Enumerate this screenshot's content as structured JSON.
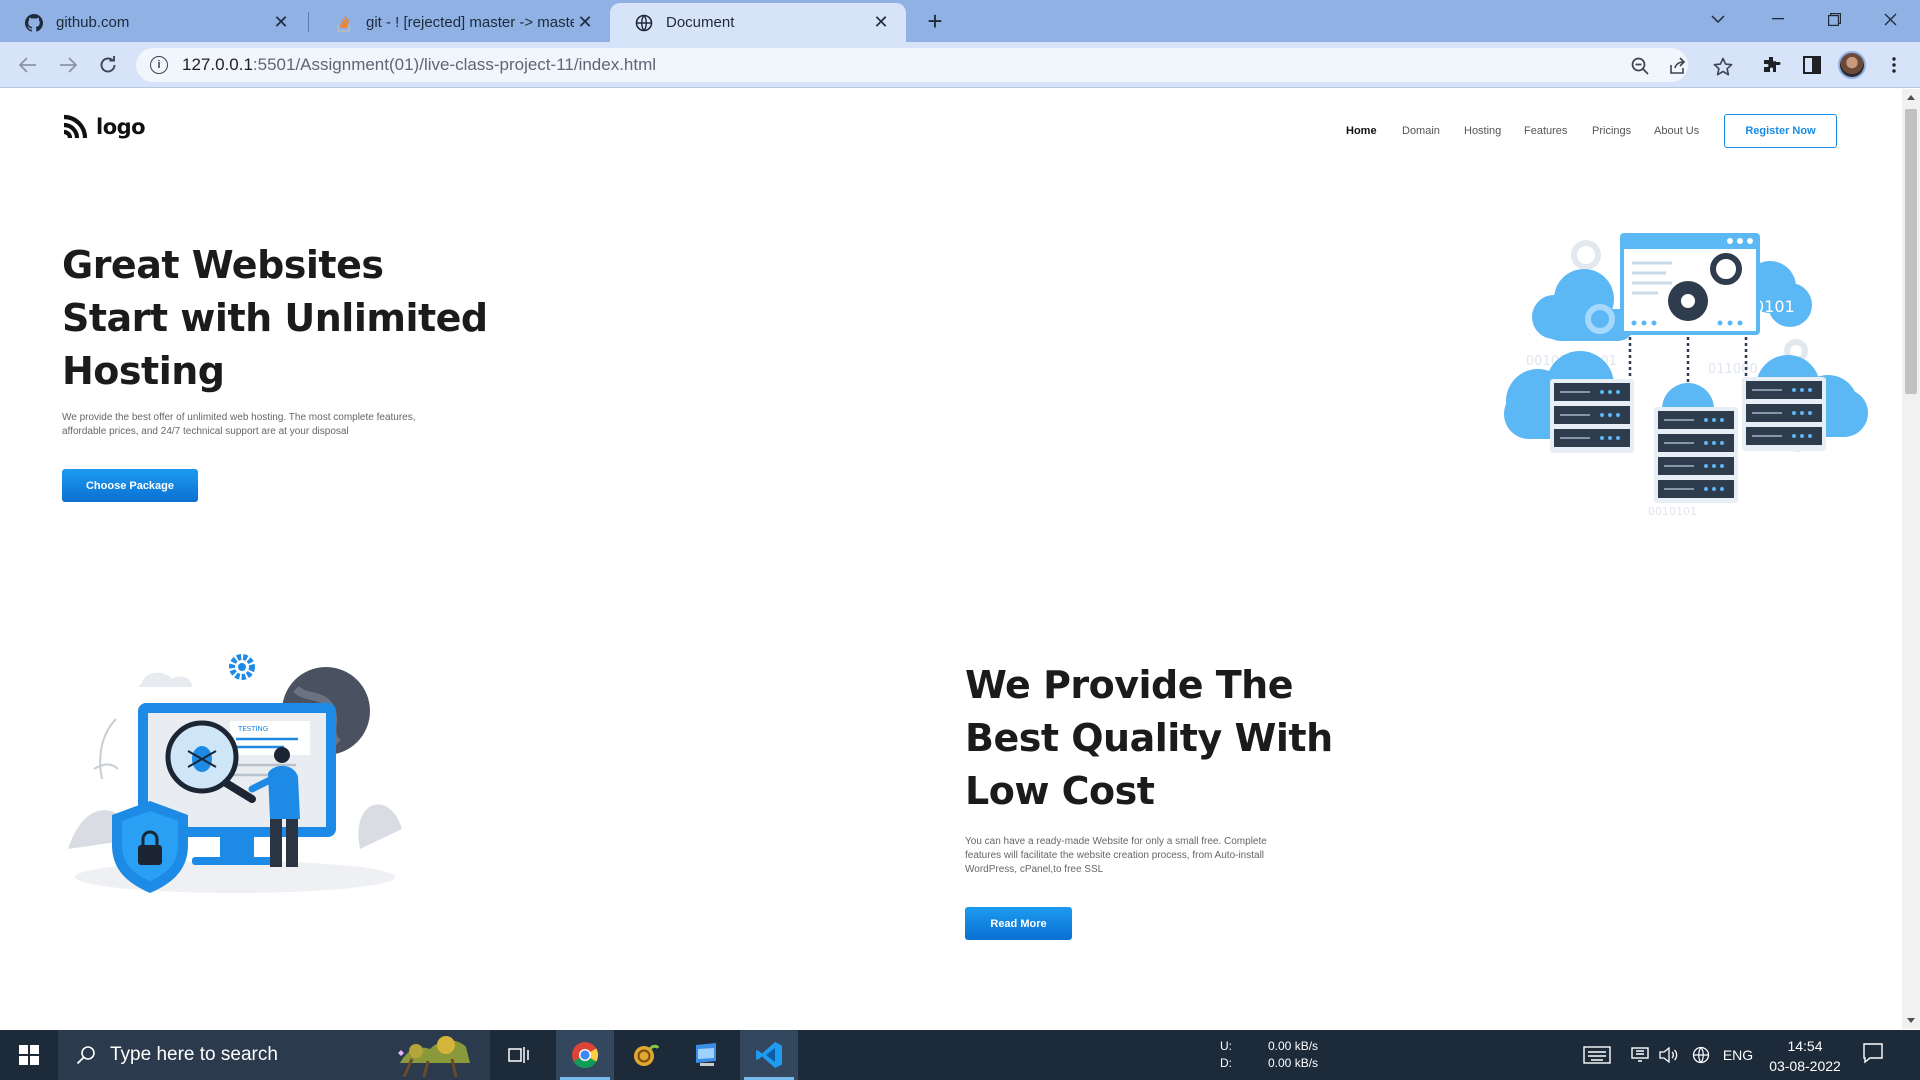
{
  "browser": {
    "tabs": [
      {
        "title": "github.com",
        "icon": "github-icon",
        "active": false
      },
      {
        "title": "git - ! [rejected] master -> master",
        "icon": "stackoverflow-icon",
        "active": false
      },
      {
        "title": "Document",
        "icon": "globe-icon",
        "active": true
      }
    ],
    "url": {
      "host": "127.0.0.1",
      "rest": ":5501/Assignment(01)/live-class-project-11/index.html"
    }
  },
  "site": {
    "logo_text": "logo",
    "nav": [
      {
        "label": "Home",
        "active": true
      },
      {
        "label": "Domain",
        "active": false
      },
      {
        "label": "Hosting",
        "active": false
      },
      {
        "label": "Features",
        "active": false
      },
      {
        "label": "Pricings",
        "active": false
      },
      {
        "label": "About Us",
        "active": false
      }
    ],
    "register_label": "Register Now",
    "hero": {
      "title": "Great Websites Start with Unlimited Hosting",
      "description": "We provide the best offer of unlimited web hosting. The most complete features, affordable prices, and 24/7 technical support are at your disposal",
      "button_label": "Choose Package"
    },
    "section2": {
      "title": "We Provide The Best Quality With Low Cost",
      "description": "You can have a ready-made Website for only a small free. Complete features will facilitate the website creation process, from Auto-install WordPress, cPanel,to free SSL",
      "button_label": "Read More",
      "illustration_label": "TESTING"
    }
  },
  "taskbar": {
    "search_placeholder": "Type here to search",
    "net": {
      "up_label": "U:",
      "up_value": "0.00 kB/s",
      "down_label": "D:",
      "down_value": "0.00 kB/s"
    },
    "language": "ENG",
    "time": "14:54",
    "date": "03-08-2022"
  },
  "colors": {
    "accent": "#1a8be3",
    "tabstrip": "#8fb1e4",
    "toolbar": "#d6e3f8",
    "taskbar": "#1c2a3a"
  }
}
